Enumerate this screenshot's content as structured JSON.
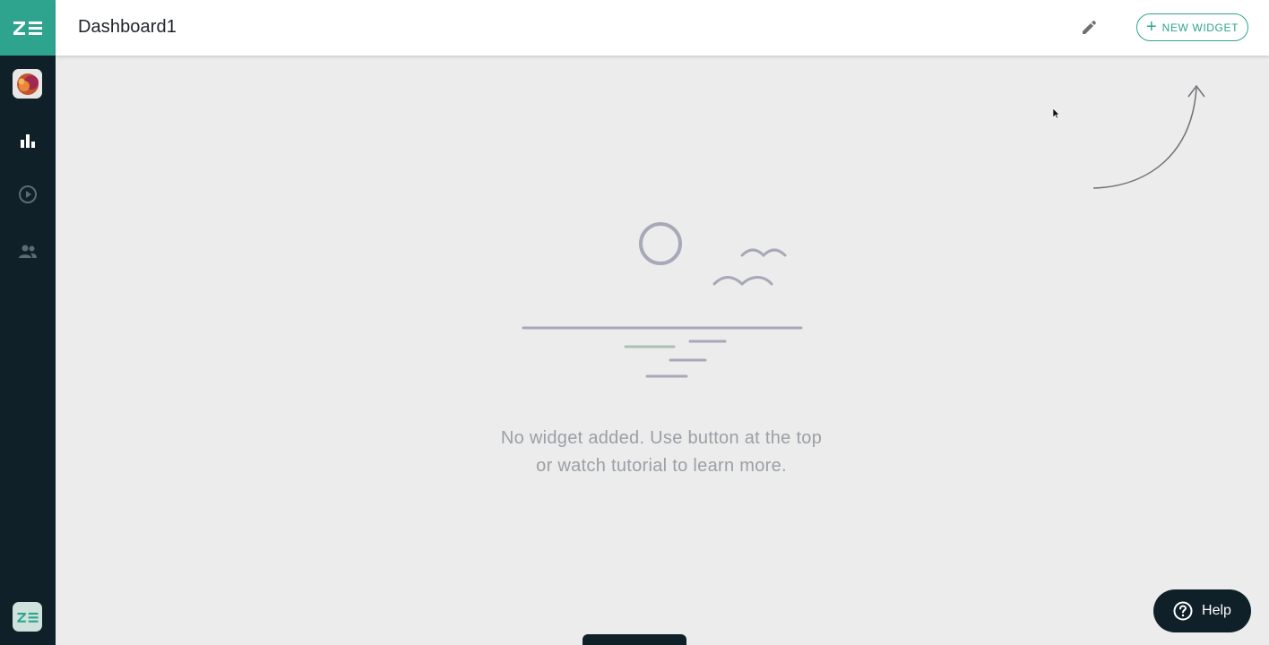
{
  "app": {
    "logo_text": "ZE",
    "brand_color": "#2ea48f",
    "sidebar_color": "#0f2029"
  },
  "sidebar": {
    "items": [
      {
        "icon": "avatar"
      },
      {
        "icon": "bar-chart-icon"
      },
      {
        "icon": "play-circle-icon"
      },
      {
        "icon": "people-icon"
      }
    ]
  },
  "header": {
    "title": "Dashboard1",
    "new_widget_label": "NEW WIDGET"
  },
  "empty_state": {
    "line1": "No widget added. Use button at the top",
    "line2": "or watch tutorial to learn more."
  },
  "help": {
    "label": "Help"
  }
}
